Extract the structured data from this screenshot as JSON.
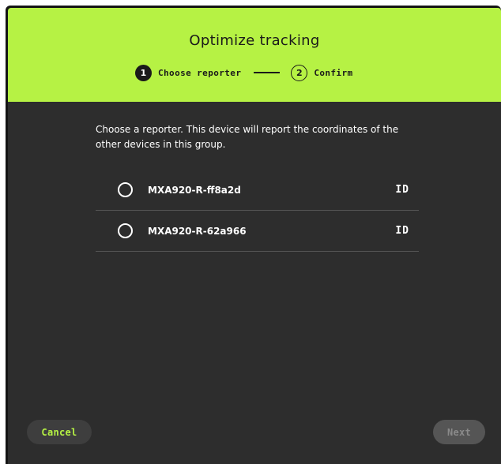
{
  "dialog": {
    "title": "Optimize tracking",
    "steps": [
      {
        "number": "1",
        "label": "Choose reporter",
        "state": "active"
      },
      {
        "number": "2",
        "label": "Confirm",
        "state": "inactive"
      }
    ],
    "instructions": "Choose a reporter. This device will report the coordinates of the other devices in this group.",
    "devices": [
      {
        "name": "MXA920-R-ff8a2d",
        "id_label": "ID",
        "selected": false
      },
      {
        "name": "MXA920-R-62a966",
        "id_label": "ID",
        "selected": false
      }
    ],
    "cancel_label": "Cancel",
    "next_label": "Next",
    "next_enabled": false
  },
  "colors": {
    "accent": "#b6f244",
    "background": "#2d2d2d",
    "header_text": "#1a1a1a",
    "disabled_button": "#555555"
  }
}
